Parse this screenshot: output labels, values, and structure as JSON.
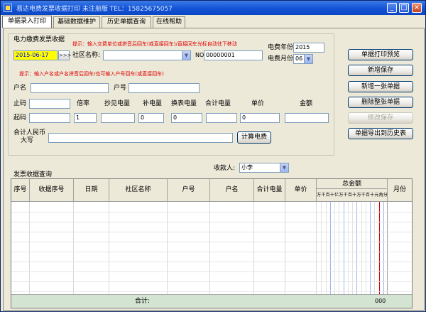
{
  "window": {
    "title": "易达电费发票收据打印 未注册版  TEL：15825675057"
  },
  "tabs": [
    {
      "label": "单据录入打印",
      "active": true
    },
    {
      "label": "基础数据维护",
      "active": false
    },
    {
      "label": "历史单据查询",
      "active": false
    },
    {
      "label": "在线帮助",
      "active": false
    }
  ],
  "form": {
    "section_title": "电力缴费发票收据",
    "hint1": "提示：输入交费单位或拼音后回车(或直接回车)/直接回车光标自动往下移动",
    "hint2": "提示：输入户名或户名拼音后回车/也可输入户号回车(或直接回车)",
    "date_value": "2015-06-17",
    "date_btn": ">>>",
    "community_label": "社区名称:",
    "community_value": "",
    "no_label": "NO",
    "no_value": "00000001",
    "year_label": "电费年份",
    "year_value": "2015",
    "month_label": "电费月份",
    "month_value": "06",
    "account_name_label": "户名",
    "account_no_label": "户号",
    "stop_label": "止码",
    "start_label": "起码",
    "col_rate": "倍率",
    "col_reading": "抄见电量",
    "col_supplement": "补电量",
    "col_meter_change": "换表电量",
    "col_total_power": "合计电量",
    "col_price": "单价",
    "col_amount": "金额",
    "rate_value": "1",
    "supplement_value": "0",
    "meter_change_value": "0",
    "price_value": "0",
    "total_rmb_label1": "合计人民币",
    "total_rmb_label2": "大写",
    "calc_btn": "计算电费"
  },
  "side_buttons": {
    "preview": "单据打印预览",
    "save_new": "新增保存",
    "add_one": "新增一张单据",
    "delete_all": "删除整张单据",
    "modify_save": "修改保存",
    "export_history": "单据导出到历史表"
  },
  "payee": {
    "label": "收款人:",
    "value": "小李"
  },
  "grid": {
    "title": "发票收据查询",
    "columns": [
      "序号",
      "收据序号",
      "日期",
      "社区名称",
      "户号",
      "户名",
      "合计电量",
      "单价",
      "总金额",
      "月份"
    ],
    "digits": [
      "万",
      "千",
      "百",
      "十",
      "亿",
      "万",
      "千",
      "百",
      "十",
      "万",
      "千",
      "百",
      "十",
      "元",
      "角",
      "分"
    ],
    "footer_label": "合计:",
    "footer_total": "000"
  }
}
